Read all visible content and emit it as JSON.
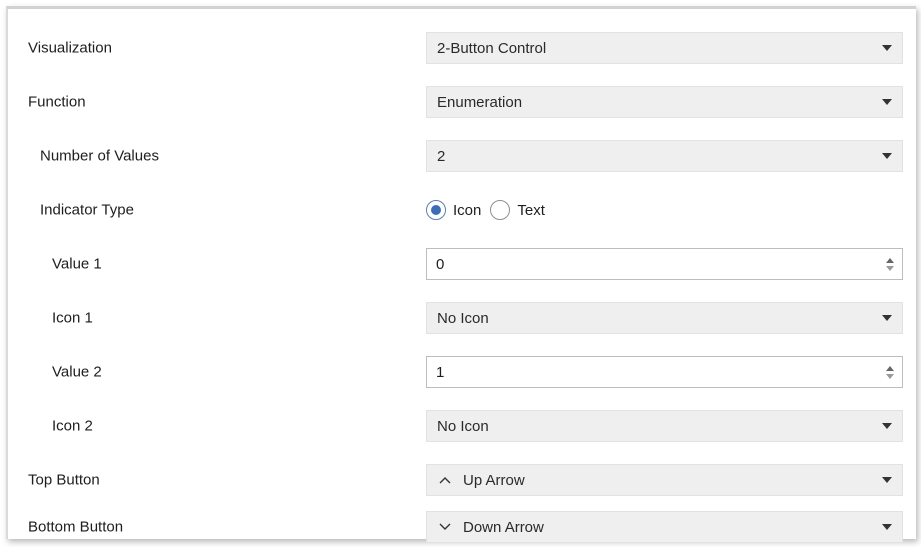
{
  "rows": {
    "visualization": {
      "label": "Visualization",
      "value": "2-Button Control"
    },
    "function": {
      "label": "Function",
      "value": "Enumeration"
    },
    "number_of_values": {
      "label": "Number of Values",
      "value": "2"
    },
    "indicator_type": {
      "label": "Indicator Type",
      "options": [
        "Icon",
        "Text"
      ],
      "selected": "Icon"
    },
    "value_1": {
      "label": "Value 1",
      "value": "0"
    },
    "icon_1": {
      "label": "Icon 1",
      "value": "No Icon"
    },
    "value_2": {
      "label": "Value 2",
      "value": "1"
    },
    "icon_2": {
      "label": "Icon 2",
      "value": "No Icon"
    },
    "top_button": {
      "label": "Top Button",
      "value": "Up Arrow",
      "icon": "chevron-up-icon"
    },
    "bottom_button": {
      "label": "Bottom Button",
      "value": "Down Arrow",
      "icon": "chevron-down-icon"
    }
  },
  "colors": {
    "select_bg": "#efefef",
    "radio_selected": "#3f6db5"
  }
}
